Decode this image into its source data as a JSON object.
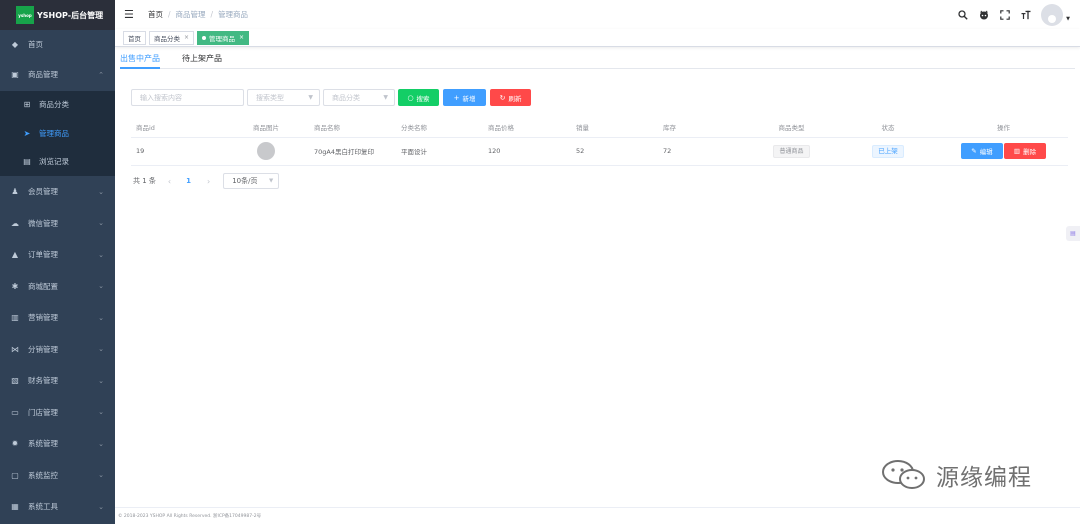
{
  "app": {
    "logo_mark": "yshop",
    "title": "YSHOP-后台管理"
  },
  "sidebar": {
    "items": [
      {
        "label": "首页",
        "icon": "dashboard-icon",
        "glyph": "◆"
      },
      {
        "label": "商品管理",
        "icon": "shop-icon",
        "glyph": "▣",
        "expanded": true,
        "children": [
          {
            "label": "商品分类",
            "icon": "category-icon",
            "glyph": "⊞",
            "active": false
          },
          {
            "label": "管理商品",
            "icon": "send-icon",
            "glyph": "➤",
            "active": true
          },
          {
            "label": "浏览记录",
            "icon": "record-icon",
            "glyph": "▤",
            "active": false
          }
        ]
      },
      {
        "label": "会员管理",
        "icon": "user-icon",
        "glyph": "♟"
      },
      {
        "label": "微信管理",
        "icon": "wechat-icon",
        "glyph": "☁"
      },
      {
        "label": "订单管理",
        "icon": "lock-icon",
        "glyph": "▲"
      },
      {
        "label": "商城配置",
        "icon": "gear-icon",
        "glyph": "✱"
      },
      {
        "label": "营销管理",
        "icon": "chart-icon",
        "glyph": "▥"
      },
      {
        "label": "分销管理",
        "icon": "share-icon",
        "glyph": "⋈"
      },
      {
        "label": "财务管理",
        "icon": "finance-icon",
        "glyph": "▧"
      },
      {
        "label": "门店管理",
        "icon": "store-icon",
        "glyph": "▭"
      },
      {
        "label": "系统管理",
        "icon": "system-icon",
        "glyph": "✹"
      },
      {
        "label": "系统监控",
        "icon": "monitor-icon",
        "glyph": "▢"
      },
      {
        "label": "系统工具",
        "icon": "tool-icon",
        "glyph": "▦"
      }
    ]
  },
  "header": {
    "breadcrumb": [
      "首页",
      "商品管理",
      "管理商品"
    ],
    "separator": "/"
  },
  "tags": [
    {
      "label": "首页",
      "active": false,
      "closable": false
    },
    {
      "label": "商品分类",
      "active": false,
      "closable": true
    },
    {
      "label": "管理商品",
      "active": true,
      "closable": true
    }
  ],
  "subtabs": [
    "出售中产品",
    "待上架产品"
  ],
  "filters": {
    "keyword_placeholder": "输入搜索内容",
    "search_type_placeholder": "搜索类型",
    "category_placeholder": "商品分类",
    "search_label": "搜索",
    "add_label": "新增",
    "refresh_label": "刷新"
  },
  "table": {
    "columns": [
      "商品id",
      "商品图片",
      "商品名称",
      "分类名称",
      "商品价格",
      "销量",
      "库存",
      "商品类型",
      "状态",
      "操作"
    ],
    "rows": [
      {
        "id": "19",
        "name": "70gA4黑白打印复印",
        "category": "平面设计",
        "price": "120",
        "sales": "52",
        "stock": "72",
        "type": "普通商品",
        "status": "已上架"
      }
    ],
    "edit_label": "编辑",
    "delete_label": "删除"
  },
  "pagination": {
    "total": "共 1 条",
    "current": "1",
    "page_size": "10条/页"
  },
  "footer": {
    "text": "© 2018-2023 YSHOP All Rights Reserved.   浙ICP备17049987-2号"
  },
  "watermark": {
    "text": "源缘编程"
  },
  "colors": {
    "sidebar": "#304156",
    "primary": "#409eff",
    "success": "#13ce66",
    "danger": "#ff4949",
    "tag_active": "#42b983"
  }
}
